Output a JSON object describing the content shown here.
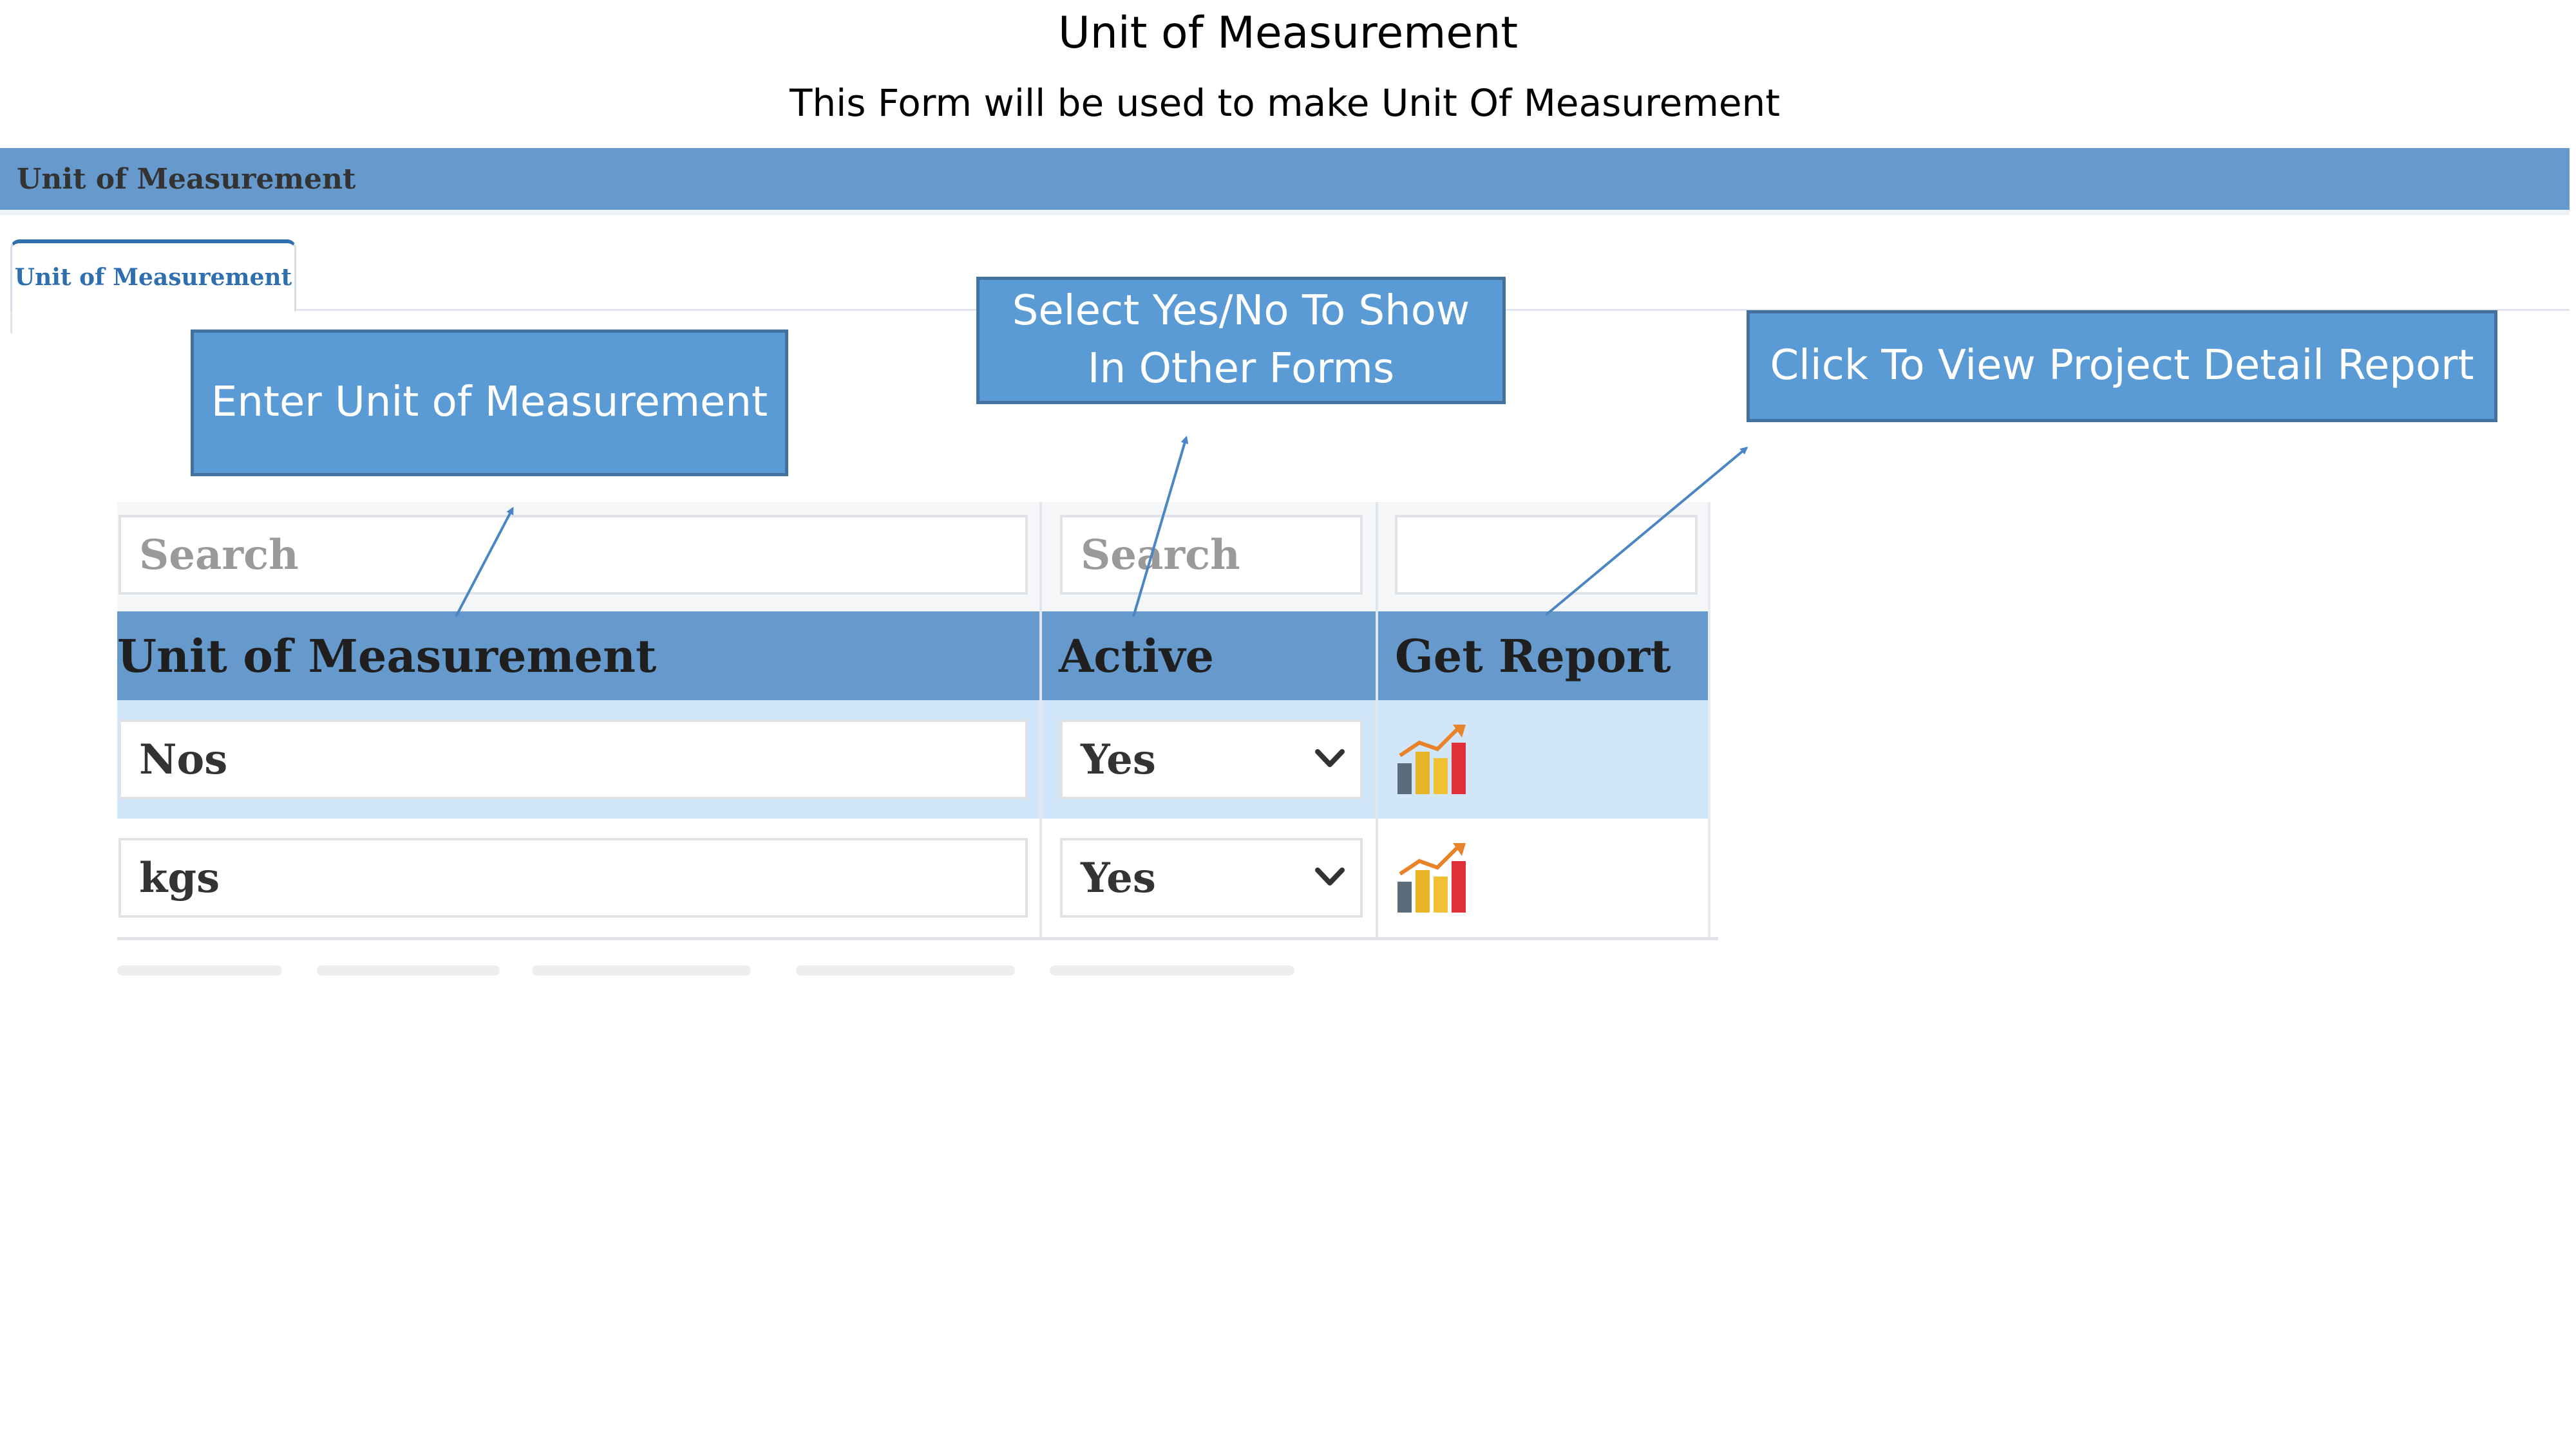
{
  "slide": {
    "title": "Unit of Measurement",
    "subtitle": "This Form will be used to make Unit Of Measurement"
  },
  "window": {
    "title": "Unit of Measurement",
    "tab_label": "Unit of Measurement"
  },
  "grid": {
    "filters": {
      "unit_placeholder": "Search",
      "active_placeholder": "Search",
      "report_placeholder": ""
    },
    "columns": [
      "Unit of Measurement",
      "Active",
      "Get Report"
    ],
    "rows": [
      {
        "unit": "Nos",
        "active": "Yes",
        "report_icon": "chart-icon",
        "selected": true
      },
      {
        "unit": "kgs",
        "active": "Yes",
        "report_icon": "chart-icon",
        "selected": false
      }
    ]
  },
  "callouts": {
    "unit": "Enter Unit of Measurement",
    "active_line1": "Select Yes/No To Show",
    "active_line2": "In Other Forms",
    "report": "Click To View Project Detail Report"
  },
  "colors": {
    "header_blue": "#6699cc",
    "callout_fill": "#5b9bd5",
    "callout_border": "#41719c",
    "selected_row": "#d2e6fa",
    "tab_accent": "#2f6fb0"
  }
}
